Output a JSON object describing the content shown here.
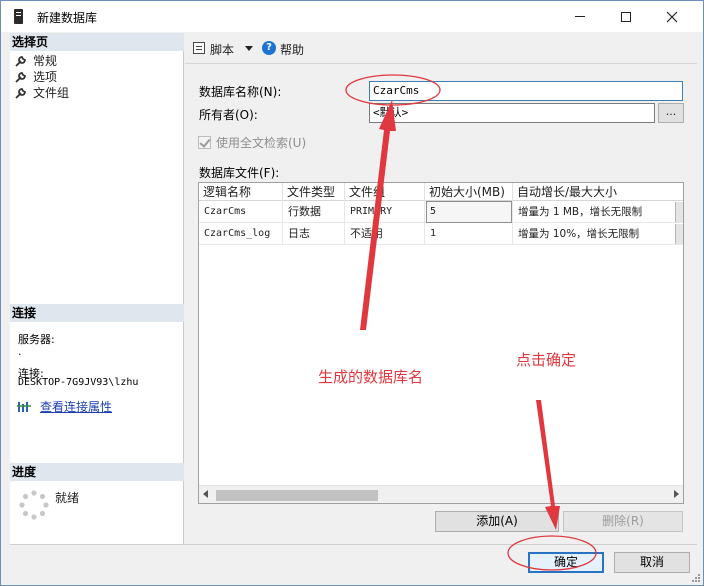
{
  "window": {
    "title": "新建数据库",
    "controls": {
      "minimize": "minimize-icon",
      "maximize": "maximize-icon",
      "close": "close-icon"
    }
  },
  "left_pane": {
    "select_page_header": "选择页",
    "pages": [
      {
        "label": "常规",
        "icon": "wrench-icon"
      },
      {
        "label": "选项",
        "icon": "wrench-icon"
      },
      {
        "label": "文件组",
        "icon": "wrench-icon"
      }
    ],
    "connection_header": "连接",
    "server_label": "服务器:",
    "server_value": ".",
    "connection_label": "连接:",
    "connection_value": "DESKTOP-7G9JV93\\lzhu",
    "view_connection_properties": "查看连接属性",
    "progress_header": "进度",
    "progress_status": "就绪"
  },
  "toolbar": {
    "script_label": "脚本",
    "help_label": "帮助"
  },
  "form": {
    "db_name_label": "数据库名称(N):",
    "db_name_value": "CzarCms",
    "owner_label": "所有者(O):",
    "owner_value": "<默认>",
    "owner_browse": "...",
    "fulltext_label": "使用全文检索(U)",
    "files_label": "数据库文件(F):"
  },
  "files_grid": {
    "columns": [
      "逻辑名称",
      "文件类型",
      "文件组",
      "初始大小(MB)",
      "自动增长/最大大小"
    ],
    "rows": [
      [
        "CzarCms",
        "行数据",
        "PRIMARY",
        "5",
        "增量为 1 MB，增长无限制"
      ],
      [
        "CzarCms_log",
        "日志",
        "不适用",
        "1",
        "增量为 10%，增长无限制"
      ]
    ]
  },
  "buttons": {
    "add": "添加(A)",
    "remove": "删除(R)",
    "ok": "确定",
    "cancel": "取消"
  },
  "annotations": {
    "generated_name": "生成的数据库名",
    "click_ok": "点击确定",
    "color": "#e0383e"
  }
}
